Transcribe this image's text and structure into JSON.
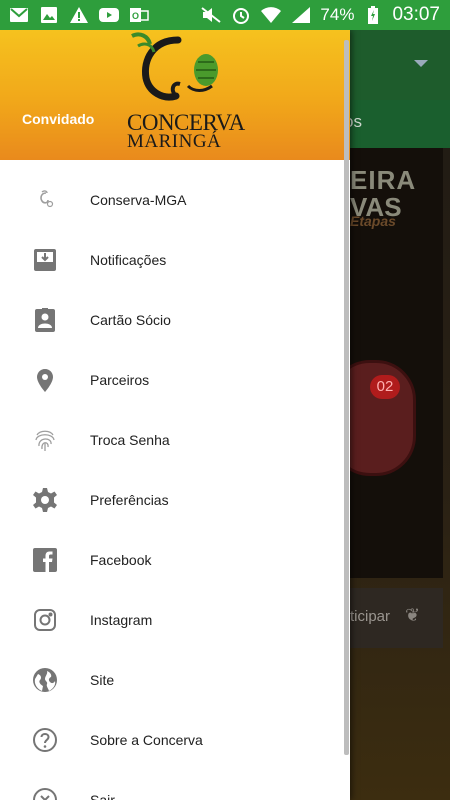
{
  "status_bar": {
    "battery": "74%",
    "time": "03:07"
  },
  "drawer": {
    "header": {
      "user": "Convidado",
      "logo_line1": "CONCERVA",
      "logo_line2": "MARINGÁ"
    },
    "menu": [
      {
        "label": "Conserva-MGA",
        "icon": "hop-icon"
      },
      {
        "label": "Notificações",
        "icon": "inbox-download-icon"
      },
      {
        "label": "Cartão Sócio",
        "icon": "member-card-icon"
      },
      {
        "label": "Parceiros",
        "icon": "location-pin-icon"
      },
      {
        "label": "Troca Senha",
        "icon": "fingerprint-icon"
      },
      {
        "label": "Preferências",
        "icon": "gear-icon"
      },
      {
        "label": "Facebook",
        "icon": "facebook-icon"
      },
      {
        "label": "Instagram",
        "icon": "instagram-icon"
      },
      {
        "label": "Site",
        "icon": "globe-icon"
      },
      {
        "label": "Sobre a Concerva",
        "icon": "help-circle-icon"
      },
      {
        "label": "Sair",
        "icon": "close-circle-icon"
      }
    ]
  },
  "background": {
    "tab_fragment": "os",
    "banner_line1": "EIRA",
    "banner_line2": "VAS",
    "banner_line3": "Etapas",
    "badge": "02",
    "card_text": "rticipar"
  },
  "colors": {
    "status_bar": "#2e9e3c",
    "header_top": "#f6c21e",
    "header_bottom": "#e98a1c",
    "icon_gray": "#757575"
  }
}
